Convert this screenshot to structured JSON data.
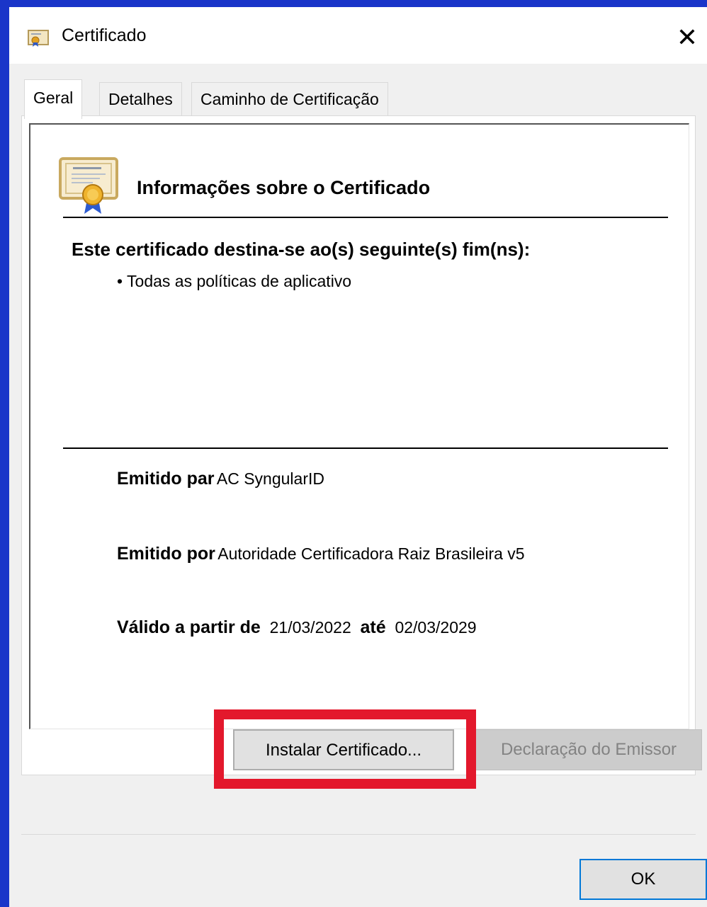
{
  "window": {
    "title": "Certificado"
  },
  "tabs": [
    "Geral",
    "Detalhes",
    "Caminho de Certificação"
  ],
  "general": {
    "heading": "Informações sobre o Certificado",
    "purpose_label": "Este certificado destina-se ao(s) seguinte(s) fim(ns):",
    "purpose_items": [
      "• Todas as políticas de aplicativo"
    ],
    "issued_to_label": "Emitido par",
    "issued_to_value": "AC SyngularID",
    "issued_by_label": "Emitido por",
    "issued_by_value": "Autoridade Certificadora Raiz Brasileira v5",
    "valid_from_label": "Válido a partir de",
    "valid_from_value": "21/03/2022",
    "valid_to_label": "até",
    "valid_to_value": "02/03/2029"
  },
  "buttons": {
    "install": "Instalar Certificado...",
    "issuer_statement": "Declaração do Emissor",
    "ok": "OK"
  },
  "icons": {
    "title": "certificate-icon",
    "close": "close-icon",
    "info": "certificate-icon"
  },
  "colors": {
    "desktop_bg": "#1a35c9",
    "highlight": "#e3182c",
    "ok_border": "#0078d7"
  }
}
